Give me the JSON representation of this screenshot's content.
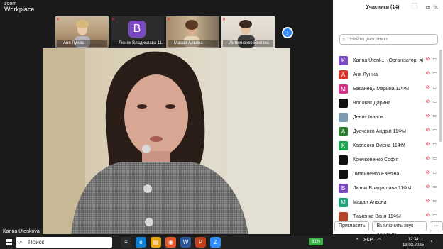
{
  "app": {
    "logo_line1": "zoom",
    "logo_line2": "Workplace"
  },
  "window_controls": {
    "minimize": "—",
    "maximize": "❐",
    "close": "✕"
  },
  "thumbnails": [
    {
      "name": "Аня Луніка",
      "type": "video"
    },
    {
      "name": "Лісняк Владислава 11...",
      "type": "avatar",
      "initial": "B",
      "color": "#7b49c2"
    },
    {
      "name": "Мацан Альона",
      "type": "video"
    },
    {
      "name": "Литвиненко Евеліна",
      "type": "video"
    }
  ],
  "strip_next": "›",
  "main_video": {
    "speaker_name": "Karina Utenkova"
  },
  "panel": {
    "title": "Учасники (14)",
    "search_placeholder": "Найти участника",
    "participants": [
      {
        "initial": "K",
        "name": "Karina Utenk... (Організатор, я)",
        "color": "#7b49c2",
        "icons": "🎤 📷"
      },
      {
        "initial": "A",
        "name": "Аня Луніка",
        "color": "#d9352b",
        "icons": "🎤 📷"
      },
      {
        "initial": "M",
        "name": "Басанець Марина 11ФМ",
        "color": "#d6338a",
        "icons": "🎤 📷"
      },
      {
        "initial": "",
        "name": "Воловик Дарина",
        "color": "#111111",
        "icons": "🎤 📷"
      },
      {
        "initial": "",
        "name": "Денис Іванов",
        "color": "#7a9bb0",
        "icons": "🎤 📷"
      },
      {
        "initial": "A",
        "name": "Дудченко Андрій 11ФМ",
        "color": "#2e7d32",
        "icons": "🎤 📷"
      },
      {
        "initial": "K",
        "name": "Карпенко Олена 11ФМ",
        "color": "#1aa34a",
        "icons": "🎤 📷"
      },
      {
        "initial": "",
        "name": "Крючковенко Софія",
        "color": "#111111",
        "icons": "🎤 📷"
      },
      {
        "initial": "",
        "name": "Литвиненко Евеліна",
        "color": "#111111",
        "icons": "🎤 📷"
      },
      {
        "initial": "B",
        "name": "Лісняк Владислава 11ФМ",
        "color": "#7b49c2",
        "icons": "🎤 📷"
      },
      {
        "initial": "M",
        "name": "Мацан Альона",
        "color": "#1aa37a",
        "icons": "🎤 📷"
      },
      {
        "initial": "",
        "name": "Ткаченко Ваня 11ФМ",
        "color": "#b5462a",
        "icons": "🎤 📷"
      }
    ],
    "invite_label": "Пригласить",
    "mute_all_label": "Выключить звук для всех",
    "more_label": "···"
  },
  "taskbar": {
    "search_label": "Поиск",
    "battery": "81%",
    "language": "УКР",
    "time": "12:34",
    "date": "13.03.2025",
    "apps": [
      {
        "glyph": "≡",
        "color": "#2b2b2b"
      },
      {
        "glyph": "e",
        "color": "#0f7fd1"
      },
      {
        "glyph": "▤",
        "color": "#e8a317"
      },
      {
        "glyph": "◉",
        "color": "#e3572b"
      },
      {
        "glyph": "W",
        "color": "#2b579a"
      },
      {
        "glyph": "P",
        "color": "#c43e1c"
      },
      {
        "glyph": "Z",
        "color": "#2d8cff"
      }
    ]
  }
}
